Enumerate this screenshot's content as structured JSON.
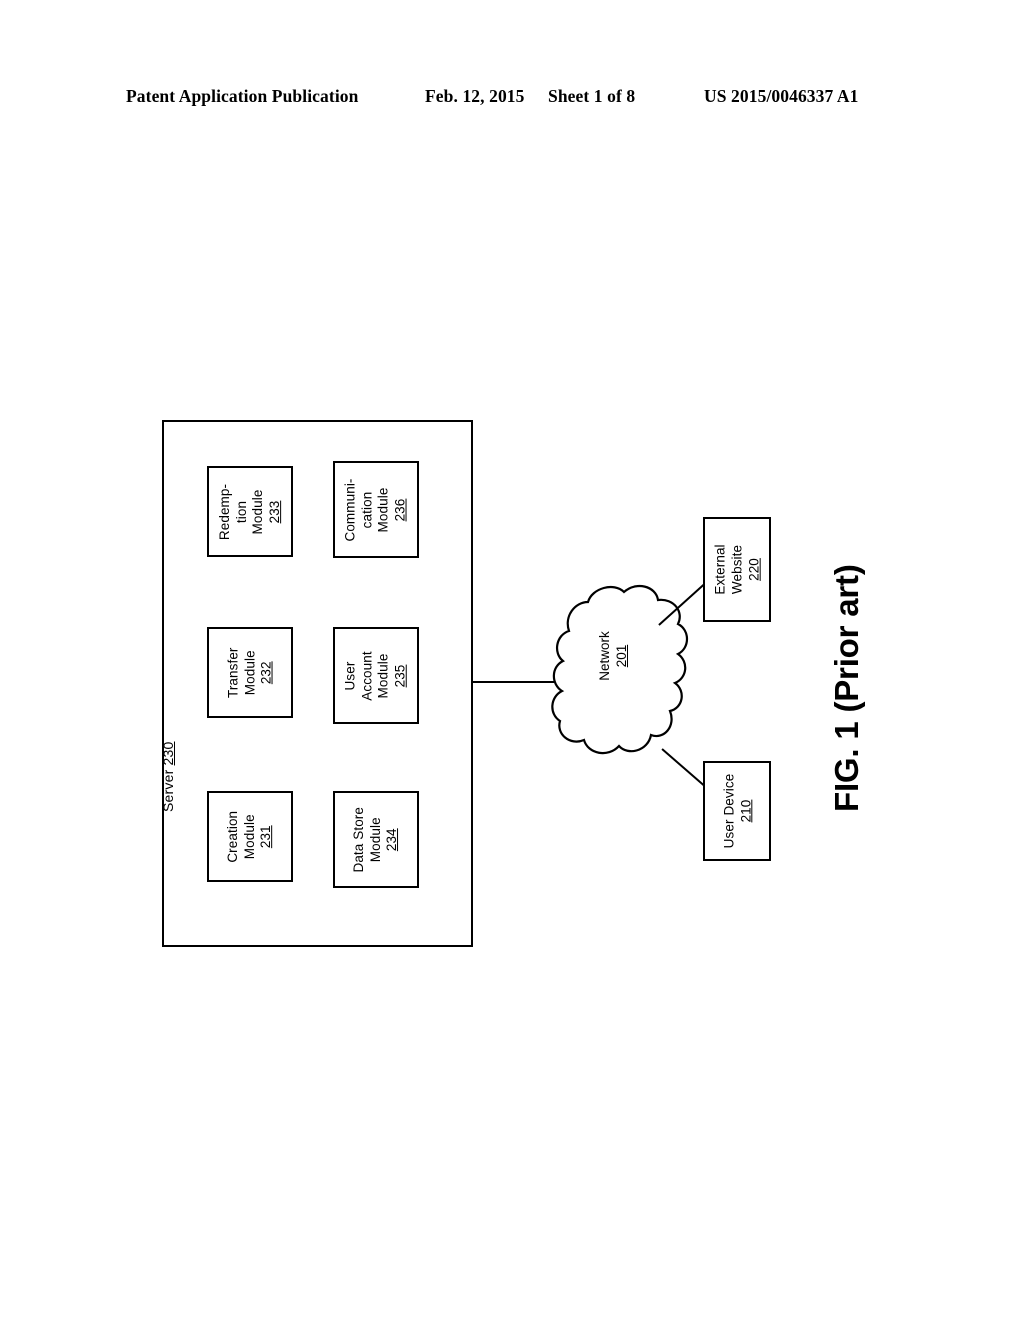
{
  "header": {
    "publication": "Patent Application Publication",
    "date": "Feb. 12, 2015",
    "sheet": "Sheet 1 of 8",
    "doc_number": "US 2015/0046337 A1"
  },
  "figure": {
    "caption": "FIG. 1 (Prior art)"
  },
  "diagram": {
    "server": {
      "label": "Server",
      "ref": "230"
    },
    "modules": [
      {
        "name": "creation-module",
        "label": "Creation\nModule",
        "ref": "231"
      },
      {
        "name": "transfer-module",
        "label": "Transfer\nModule",
        "ref": "232"
      },
      {
        "name": "redemption-module",
        "label": "Redemp-\ntion\nModule",
        "ref": "233"
      },
      {
        "name": "data-store-module",
        "label": "Data Store\nModule",
        "ref": "234"
      },
      {
        "name": "user-account-module",
        "label": "User\nAccount\nModule",
        "ref": "235"
      },
      {
        "name": "communication-module",
        "label": "Communi-\ncation\nModule",
        "ref": "236"
      }
    ],
    "network": {
      "label": "Network",
      "ref": "201"
    },
    "external_website": {
      "label": "External\nWebsite",
      "ref": "220"
    },
    "user_device": {
      "label": "User Device",
      "ref": "210"
    }
  },
  "colors": {
    "ink": "#000000",
    "paper": "#ffffff"
  }
}
